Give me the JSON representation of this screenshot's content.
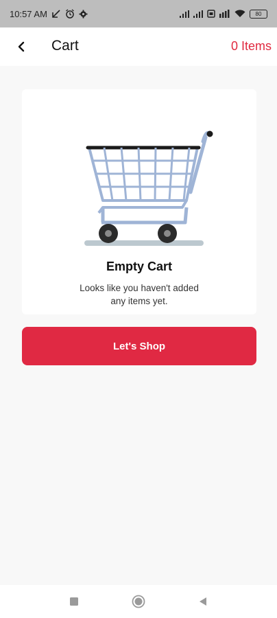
{
  "status_bar": {
    "time": "10:57 AM",
    "left_icons": [
      "missed-call-icon",
      "alarm-icon",
      "settings-gear-icon"
    ],
    "right_icons": [
      "signal-icon",
      "signal-icon",
      "sim-card-icon",
      "volte-icon",
      "wifi-icon",
      "battery-icon"
    ],
    "battery_level": "80"
  },
  "app_bar": {
    "back_icon": "chevron-left-icon",
    "title": "Cart",
    "items_count_label": "0 Items",
    "accent_color": "#e0293f"
  },
  "empty_state": {
    "illustration": "shopping-cart-icon",
    "title": "Empty Cart",
    "description": "Looks like you haven't added any items yet."
  },
  "actions": {
    "shop_label": "Let's Shop",
    "button_color": "#e02943"
  },
  "nav_bar": {
    "buttons": [
      "recent-apps-icon",
      "home-icon",
      "back-triangle-icon"
    ]
  }
}
